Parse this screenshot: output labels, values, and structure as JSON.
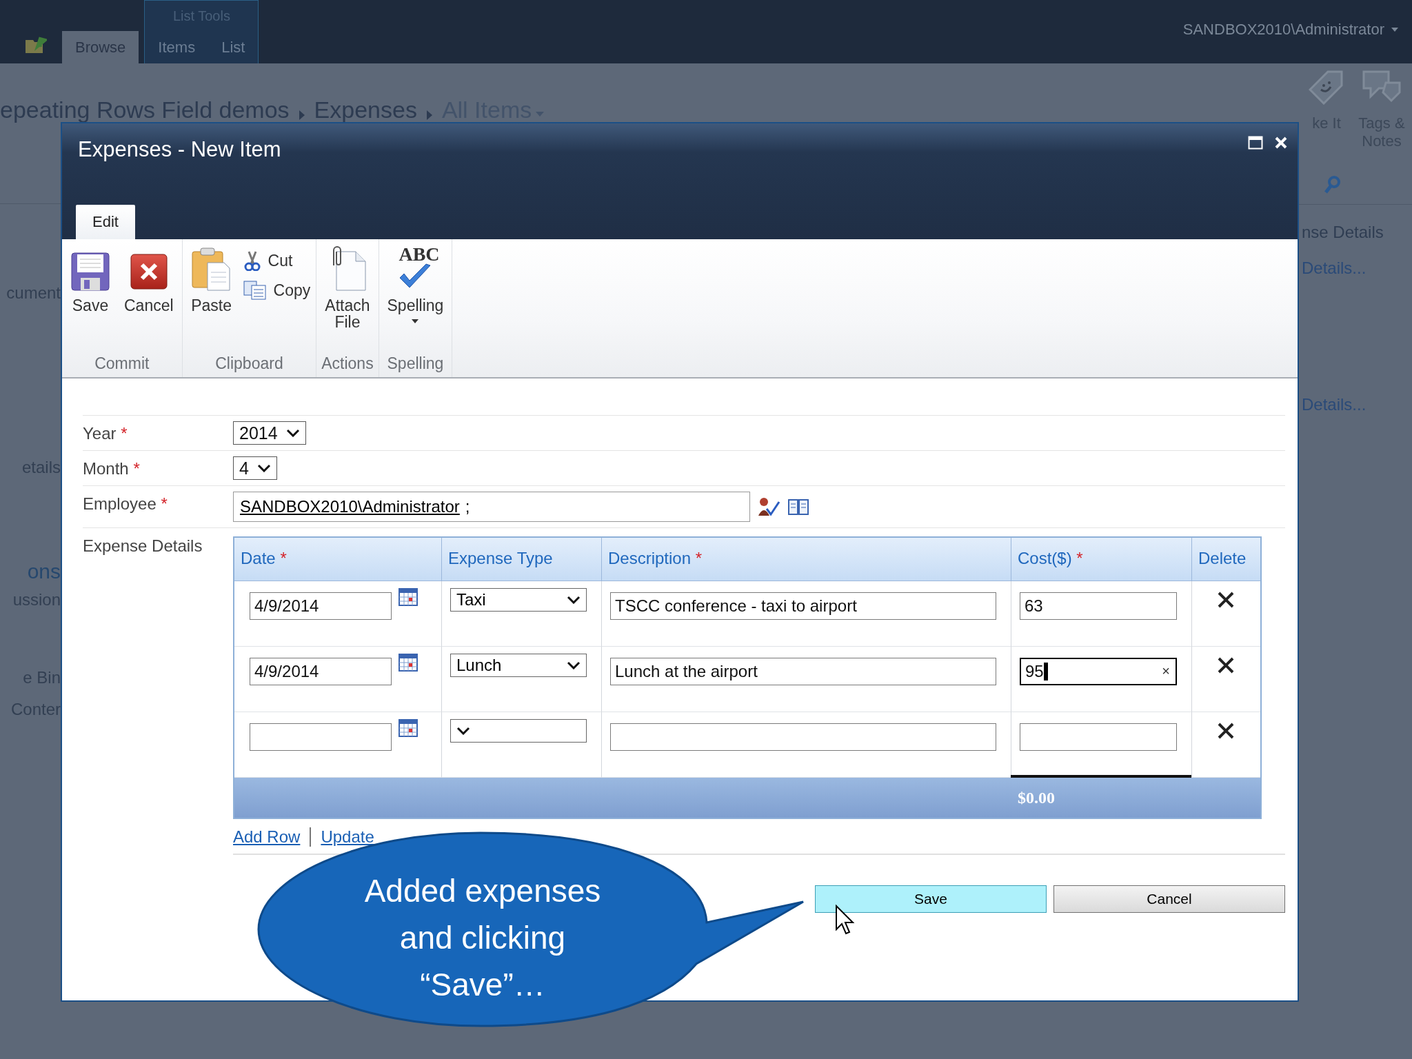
{
  "top_bar": {
    "tab_group": "List Tools",
    "tabs": [
      {
        "label": "Browse",
        "selected": true
      },
      {
        "label": "Items",
        "selected": false
      },
      {
        "label": "List",
        "selected": false
      }
    ],
    "user": "SANDBOX2010\\Administrator"
  },
  "breadcrumb": {
    "items": [
      "epeating Rows Field demos",
      "Expenses",
      "All Items"
    ]
  },
  "page_ribbon": {
    "buttons": [
      {
        "label": "ke It"
      },
      {
        "label": "Tags & Notes"
      }
    ]
  },
  "left_nav": {
    "items": [
      {
        "label": "cument",
        "kind": "link"
      },
      {
        "label": "etails",
        "kind": "link"
      },
      {
        "label": "ons",
        "kind": "heading"
      },
      {
        "label": "ussion",
        "kind": "link"
      },
      {
        "label": "e Bin",
        "kind": "link"
      },
      {
        "label": "Conter",
        "kind": "link"
      }
    ]
  },
  "right_panel": {
    "items": [
      {
        "label": "nse Details",
        "kind": "heading"
      },
      {
        "label": "Details...",
        "kind": "link"
      },
      {
        "label": "Details...",
        "kind": "link"
      }
    ]
  },
  "dialog": {
    "title": "Expenses - New Item",
    "ribbon_tab": "Edit",
    "groups": [
      {
        "label": "Commit",
        "buttons": [
          {
            "label": "Save"
          },
          {
            "label": "Cancel"
          }
        ]
      },
      {
        "label": "Clipboard",
        "buttons": [
          {
            "label": "Paste"
          }
        ],
        "small_buttons": [
          {
            "label": "Cut"
          },
          {
            "label": "Copy"
          }
        ]
      },
      {
        "label": "Actions",
        "buttons": [
          {
            "label": "Attach File"
          }
        ]
      },
      {
        "label": "Spelling",
        "buttons": [
          {
            "label": "Spelling",
            "icon_text": "ABC",
            "dropdown": true
          }
        ]
      }
    ],
    "fields": [
      {
        "label": "Year",
        "required_mark": "*",
        "kind": "select",
        "value": "2014"
      },
      {
        "label": "Month",
        "required_mark": "*",
        "kind": "select",
        "value": "4"
      },
      {
        "label": "Employee",
        "required_mark": "*",
        "kind": "people",
        "value": "SANDBOX2010\\Administrator",
        "suffix": ";"
      }
    ],
    "expense_details": {
      "label": "Expense Details",
      "columns": [
        {
          "label": "Date",
          "required_mark": "*"
        },
        {
          "label": "Expense Type"
        },
        {
          "label": "Description",
          "required_mark": "*"
        },
        {
          "label": "Cost($)",
          "required_mark": "*"
        },
        {
          "label": "Delete"
        }
      ],
      "rows": [
        {
          "date": "4/9/2014",
          "type": "Taxi",
          "description": "TSCC conference - taxi to airport",
          "cost": "63",
          "focused": false
        },
        {
          "date": "4/9/2014",
          "type": "Lunch",
          "description": "Lunch at the airport",
          "cost": "95",
          "focused": true,
          "clear_button": "×"
        },
        {
          "focused": false
        }
      ],
      "total": "$0.00",
      "links": [
        "Add Row",
        "Update"
      ]
    },
    "buttons": [
      {
        "label": "Save",
        "hovered": true
      },
      {
        "label": "Cancel",
        "hovered": false
      }
    ]
  },
  "callout": {
    "text": "Added expenses and clicking “Save”…"
  }
}
